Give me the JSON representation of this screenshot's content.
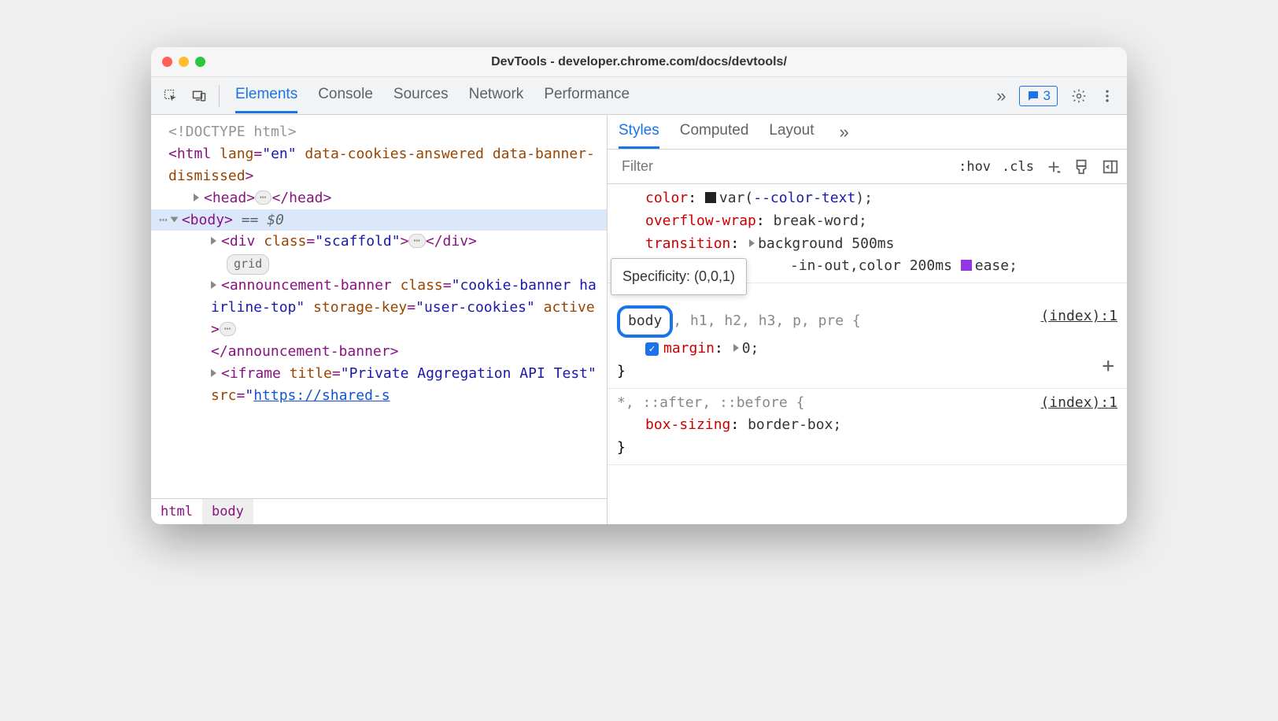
{
  "window_title": "DevTools - developer.chrome.com/docs/devtools/",
  "toolbar": {
    "tabs": [
      "Elements",
      "Console",
      "Sources",
      "Network",
      "Performance"
    ],
    "active_tab": "Elements",
    "issues_count": "3"
  },
  "dom": {
    "doctype": "<!DOCTYPE html>",
    "html_open": "<html lang=\"en\" data-cookies-answered data-banner-dismissed>",
    "head": {
      "open": "<head>",
      "close": "</head>"
    },
    "body_open": "<body>",
    "eq0": " == $0",
    "scaffold": {
      "open": "<div class=\"scaffold\">",
      "close": "</div>",
      "badge": "grid"
    },
    "announcement": {
      "text_open_pre": "<announcement-banner class=",
      "class_val": "\"cookie-banner hairline-top\"",
      "attr2": " storage-key=",
      "attr2_val": "\"user-cookies\"",
      "attr3": " active>",
      "close_tag": "</announcement-banner>"
    },
    "iframe": {
      "pre": "<iframe title=",
      "title_val": "\"Private Aggregation API Test\"",
      "src_attr": " src=",
      "src_val": "\"https://shared-s"
    }
  },
  "breadcrumb": [
    "html",
    "body"
  ],
  "styles_tabs": [
    "Styles",
    "Computed",
    "Layout"
  ],
  "styles_active": "Styles",
  "filter_placeholder": "Filter",
  "hov": ":hov",
  "cls": ".cls",
  "rules": {
    "r0": {
      "p1": {
        "name": "color",
        "val_prefix": "var(",
        "var": "--color-text",
        "val_suffix": ");"
      },
      "p2": {
        "name": "overflow-wrap",
        "val": "break-word;"
      },
      "p3": {
        "name": "transition",
        "val1": "background 500ms",
        "val2_pre": "-in-out,color 200ms ",
        "val2_post": "ease;"
      }
    },
    "r1": {
      "sel_body": "body",
      "sel_rest": ", h1, h2, h3, p, pre {",
      "src": "(index):1",
      "p1": {
        "name": "margin",
        "val": "0;"
      },
      "close": "}"
    },
    "r2": {
      "sel": "*, ::after, ::before {",
      "src": "(index):1",
      "p1": {
        "name": "box-sizing",
        "val": "border-box;"
      },
      "close": "}"
    }
  },
  "tooltip": "Specificity: (0,0,1)"
}
